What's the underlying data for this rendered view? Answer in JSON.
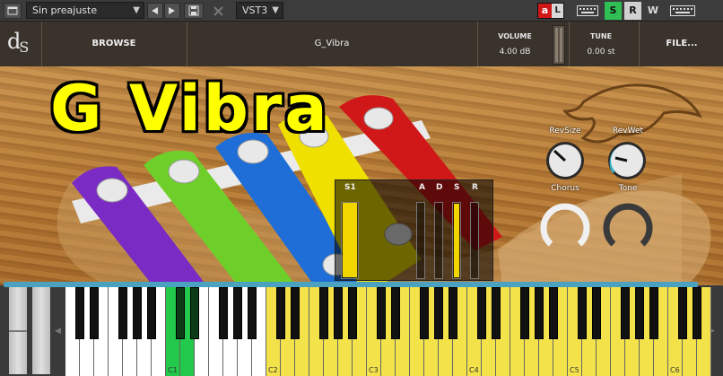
{
  "host": {
    "preset": "Sin preajuste",
    "format": "VST3",
    "prev_icon": "triangle-left-icon",
    "next_icon": "triangle-right-icon",
    "save_icon": "save-icon",
    "close_icon": "close-icon",
    "toggle_a": "a",
    "toggle_l": "L",
    "s_btn": "S",
    "r_btn": "R",
    "w_btn": "W"
  },
  "header": {
    "logo_d": "d",
    "logo_s": "S",
    "browse": "BROWSE",
    "instrument": "G_Vibra",
    "volume_label": "VOLUME",
    "volume_value": "4.00 dB",
    "tune_label": "TUNE",
    "tune_value": "0.00 st",
    "file": "FILE..."
  },
  "main": {
    "title": "G Vibra",
    "knobs": {
      "revsize": "RevSize",
      "revwet": "RevWet",
      "chorus": "Chorus",
      "tone": "Tone"
    },
    "envelope": {
      "s1": "S1",
      "a": "A",
      "d": "D",
      "s": "S",
      "r": "R"
    }
  },
  "keyboard": {
    "notes": [
      "C1",
      "C2",
      "C3",
      "C4",
      "C5",
      "C6"
    ]
  },
  "colors": {
    "accent_green": "#22c94a",
    "key_yellow": "#f4e24a",
    "title_yellow": "#ffff00"
  }
}
